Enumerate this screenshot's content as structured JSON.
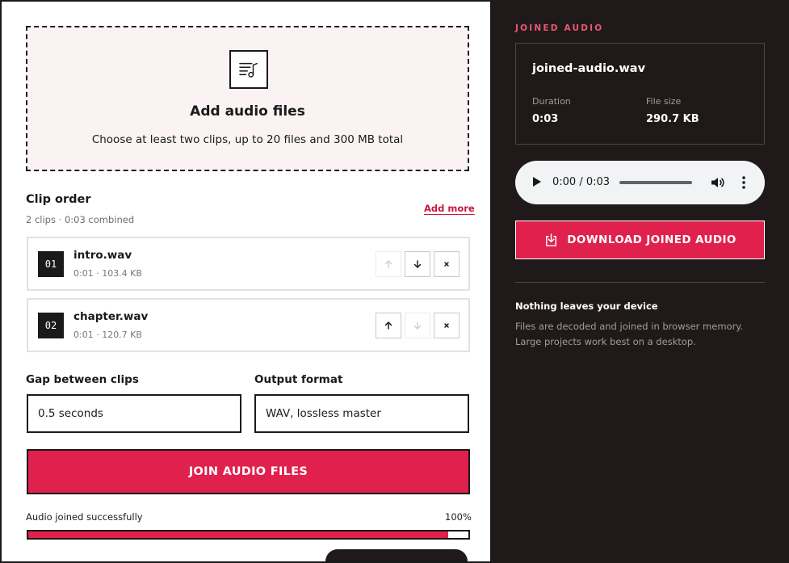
{
  "upload": {
    "title": "Add audio files",
    "subtitle": "Choose at least two clips, up to 20 files and 300 MB total",
    "icon": "audio-list-icon"
  },
  "clip_order": {
    "title": "Clip order",
    "summary": "2 clips · 0:03 combined",
    "add_more_label": "Add more"
  },
  "clips": [
    {
      "number": "01",
      "name": "intro.wav",
      "meta": "0:01 · 103.4 KB",
      "can_move_up": false,
      "can_move_down": true
    },
    {
      "number": "02",
      "name": "chapter.wav",
      "meta": "0:01 · 120.7 KB",
      "can_move_up": true,
      "can_move_down": false
    }
  ],
  "settings": {
    "gap_label": "Gap between clips",
    "gap_value": "0.5 seconds",
    "format_label": "Output format",
    "format_value": "WAV, lossless master"
  },
  "join_button_label": "JOIN AUDIO FILES",
  "progress": {
    "status": "Audio joined successfully",
    "percent_label": "100%",
    "fill_fraction": 0.955
  },
  "result": {
    "heading": "JOINED AUDIO",
    "file_name": "joined-audio.wav",
    "duration_label": "Duration",
    "duration_value": "0:03",
    "size_label": "File size",
    "size_value": "290.7 KB"
  },
  "player": {
    "time": "0:00 / 0:03"
  },
  "download_label": "DOWNLOAD JOINED AUDIO",
  "privacy": {
    "title": "Nothing leaves your device",
    "text": "Files are decoded and joined in browser memory. Large projects work best on a desktop."
  },
  "colors": {
    "accent": "#e0204d",
    "accent_text": "#c8173e",
    "panel_dark": "#1f1a19",
    "heading_pink": "#ec5576"
  }
}
